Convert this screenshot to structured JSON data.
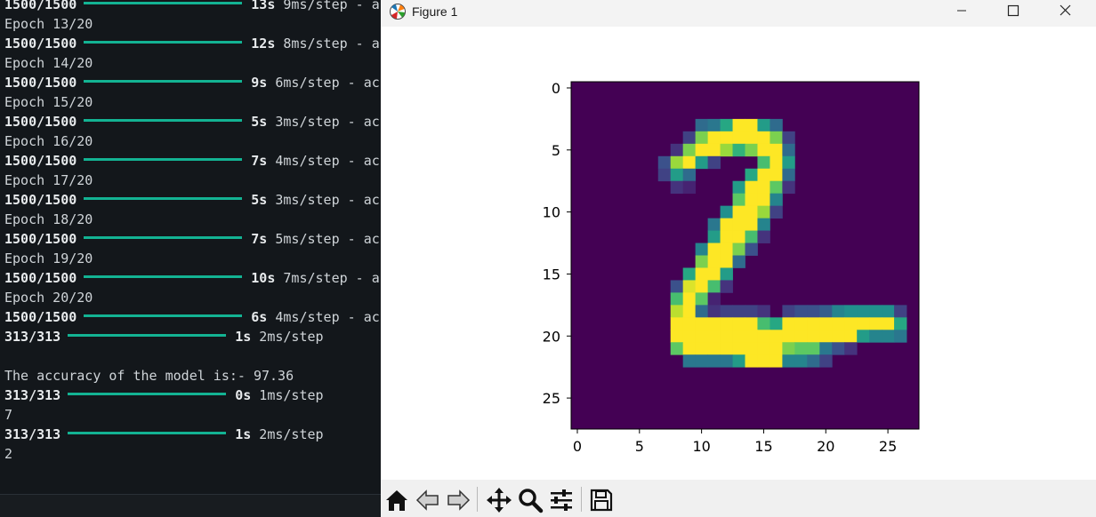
{
  "terminal": {
    "lines": [
      {
        "type": "progress",
        "count": "1500/1500",
        "time": "13s",
        "rate": "9ms/step",
        "tail": "- a"
      },
      {
        "type": "text",
        "text": "Epoch 13/20"
      },
      {
        "type": "progress",
        "count": "1500/1500",
        "time": "12s",
        "rate": "8ms/step",
        "tail": "- a"
      },
      {
        "type": "text",
        "text": "Epoch 14/20"
      },
      {
        "type": "progress",
        "count": "1500/1500",
        "time": "9s",
        "rate": "6ms/step",
        "tail": "- ac"
      },
      {
        "type": "text",
        "text": "Epoch 15/20"
      },
      {
        "type": "progress",
        "count": "1500/1500",
        "time": "5s",
        "rate": "3ms/step",
        "tail": "- ac"
      },
      {
        "type": "text",
        "text": "Epoch 16/20"
      },
      {
        "type": "progress",
        "count": "1500/1500",
        "time": "7s",
        "rate": "4ms/step",
        "tail": "- ac"
      },
      {
        "type": "text",
        "text": "Epoch 17/20"
      },
      {
        "type": "progress",
        "count": "1500/1500",
        "time": "5s",
        "rate": "3ms/step",
        "tail": "- ac"
      },
      {
        "type": "text",
        "text": "Epoch 18/20"
      },
      {
        "type": "progress",
        "count": "1500/1500",
        "time": "7s",
        "rate": "5ms/step",
        "tail": "- ac"
      },
      {
        "type": "text",
        "text": "Epoch 19/20"
      },
      {
        "type": "progress",
        "count": "1500/1500",
        "time": "10s",
        "rate": "7ms/step",
        "tail": "- a"
      },
      {
        "type": "text",
        "text": "Epoch 20/20"
      },
      {
        "type": "progress",
        "count": "1500/1500",
        "time": "6s",
        "rate": "4ms/step",
        "tail": "- ac"
      },
      {
        "type": "progress",
        "count": "313/313",
        "time": "1s",
        "rate": "2ms/step",
        "tail": ""
      },
      {
        "type": "text",
        "text": ""
      },
      {
        "type": "text",
        "text": "The accuracy of the model is:- 97.36"
      },
      {
        "type": "progress",
        "count": "313/313",
        "time": "0s",
        "rate": "1ms/step",
        "tail": ""
      },
      {
        "type": "text",
        "text": "7"
      },
      {
        "type": "progress",
        "count": "313/313",
        "time": "1s",
        "rate": "2ms/step",
        "tail": ""
      },
      {
        "type": "text",
        "text": "2"
      }
    ],
    "colors": {
      "progress_bar": "#13b393",
      "text": "#cfd4d8",
      "background": "#13171b"
    }
  },
  "figure": {
    "title": "Figure 1",
    "controls": {
      "minimize": "minimize-icon",
      "maximize": "maximize-icon",
      "close": "close-icon"
    },
    "toolbar": [
      "home-icon",
      "back-arrow-icon",
      "forward-arrow-icon",
      "pan-move-icon",
      "zoom-magnifier-icon",
      "configure-subplots-icon",
      "save-icon"
    ]
  },
  "chart_data": {
    "type": "heatmap",
    "colormap": "viridis",
    "xticks": [
      0,
      5,
      10,
      15,
      20,
      25
    ],
    "yticks": [
      0,
      5,
      10,
      15,
      20,
      25
    ],
    "xlim": [
      -0.5,
      27.5
    ],
    "ylim": [
      27.5,
      -0.5
    ],
    "grid": false,
    "image_size": [
      28,
      28
    ],
    "pixel_values": {
      "r3": {
        "10": 0.35,
        "11": 0.4,
        "12": 0.6,
        "13": 1,
        "14": 1,
        "15": 0.55,
        "16": 0.35
      },
      "r4": {
        "9": 0.2,
        "10": 0.8,
        "11": 1,
        "12": 1,
        "13": 1,
        "14": 1,
        "15": 1,
        "16": 0.8,
        "17": 0.2
      },
      "r5": {
        "8": 0.15,
        "9": 0.8,
        "10": 1,
        "11": 1,
        "12": 0.85,
        "13": 0.65,
        "14": 0.8,
        "15": 1,
        "16": 1,
        "17": 0.35
      },
      "r6": {
        "7": 0.25,
        "8": 0.85,
        "9": 1,
        "10": 0.55,
        "11": 0.2,
        "15": 0.7,
        "16": 1,
        "17": 0.55
      },
      "r7": {
        "7": 0.2,
        "8": 0.55,
        "9": 0.35,
        "14": 0.6,
        "15": 1,
        "16": 1,
        "17": 0.35
      },
      "r8": {
        "8": 0.15,
        "9": 0.1,
        "13": 0.55,
        "14": 1,
        "15": 1,
        "16": 0.75,
        "17": 0.15
      },
      "r9": {
        "13": 0.75,
        "14": 1,
        "15": 1,
        "16": 0.45
      },
      "r10": {
        "12": 0.5,
        "13": 1,
        "14": 1,
        "15": 0.85,
        "16": 0.2
      },
      "r11": {
        "11": 0.4,
        "12": 1,
        "13": 1,
        "14": 1,
        "15": 0.45
      },
      "r12": {
        "11": 0.55,
        "12": 1,
        "13": 1,
        "14": 0.7,
        "15": 0.15
      },
      "r13": {
        "10": 0.45,
        "11": 1,
        "12": 1,
        "13": 0.8,
        "14": 0.25
      },
      "r14": {
        "10": 0.8,
        "11": 1,
        "12": 1,
        "13": 0.35
      },
      "r15": {
        "9": 0.6,
        "10": 1,
        "11": 1,
        "12": 0.55
      },
      "r16": {
        "8": 0.25,
        "9": 0.95,
        "10": 1,
        "11": 0.7,
        "12": 0.15
      },
      "r17": {
        "8": 0.7,
        "9": 1,
        "10": 0.75,
        "11": 0.1
      },
      "r18": {
        "8": 0.9,
        "9": 1,
        "10": 0.35,
        "11": 0.15,
        "12": 0.2,
        "13": 0.2,
        "14": 0.2,
        "15": 0.15,
        "17": 0.2,
        "18": 0.25,
        "19": 0.25,
        "20": 0.3,
        "21": 0.45,
        "22": 0.5,
        "23": 0.5,
        "24": 0.5,
        "25": 0.5,
        "26": 0.2
      },
      "r19": {
        "8": 1,
        "9": 1,
        "10": 1,
        "11": 1,
        "12": 1,
        "13": 1,
        "14": 1,
        "15": 0.7,
        "16": 0.6,
        "17": 1,
        "18": 1,
        "19": 1,
        "20": 1,
        "21": 1,
        "22": 1,
        "23": 1,
        "24": 1,
        "25": 1,
        "26": 0.6
      },
      "r20": {
        "8": 1,
        "9": 1,
        "10": 1,
        "11": 1,
        "12": 1,
        "13": 1,
        "14": 1,
        "15": 1,
        "16": 1,
        "17": 1,
        "18": 1,
        "19": 1,
        "20": 1,
        "21": 1,
        "22": 1,
        "23": 0.55,
        "24": 0.45,
        "25": 0.45,
        "26": 0.4
      },
      "r21": {
        "8": 0.75,
        "9": 1,
        "10": 1,
        "11": 1,
        "12": 1,
        "13": 1,
        "14": 1,
        "15": 1,
        "16": 1,
        "17": 0.8,
        "18": 0.75,
        "19": 0.75,
        "20": 0.4,
        "21": 0.25,
        "22": 0.15
      },
      "r22": {
        "9": 0.4,
        "10": 0.4,
        "11": 0.4,
        "12": 0.4,
        "13": 0.55,
        "14": 1,
        "15": 1,
        "16": 1,
        "17": 0.45,
        "18": 0.45,
        "19": 0.35,
        "20": 0.2
      }
    }
  }
}
